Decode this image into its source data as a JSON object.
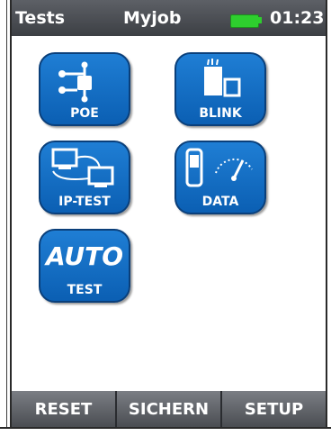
{
  "header": {
    "title": "Tests",
    "job": "Myjob",
    "time": "01:23",
    "battery_icon": "battery-full-icon",
    "battery_color": "#2ecf2e"
  },
  "tiles": [
    {
      "label": "POE",
      "icon": "poe-icon"
    },
    {
      "label": "BLINK",
      "icon": "blink-icon"
    },
    {
      "label": "IP-TEST",
      "icon": "ip-test-icon"
    },
    {
      "label": "DATA",
      "icon": "data-icon"
    },
    {
      "label": "TEST",
      "big_text": "AUTO"
    }
  ],
  "softkeys": [
    "RESET",
    "SICHERN",
    "SETUP"
  ],
  "colors": {
    "tile_blue": "#1f7ed4",
    "titlebar": "#4a4d52"
  }
}
